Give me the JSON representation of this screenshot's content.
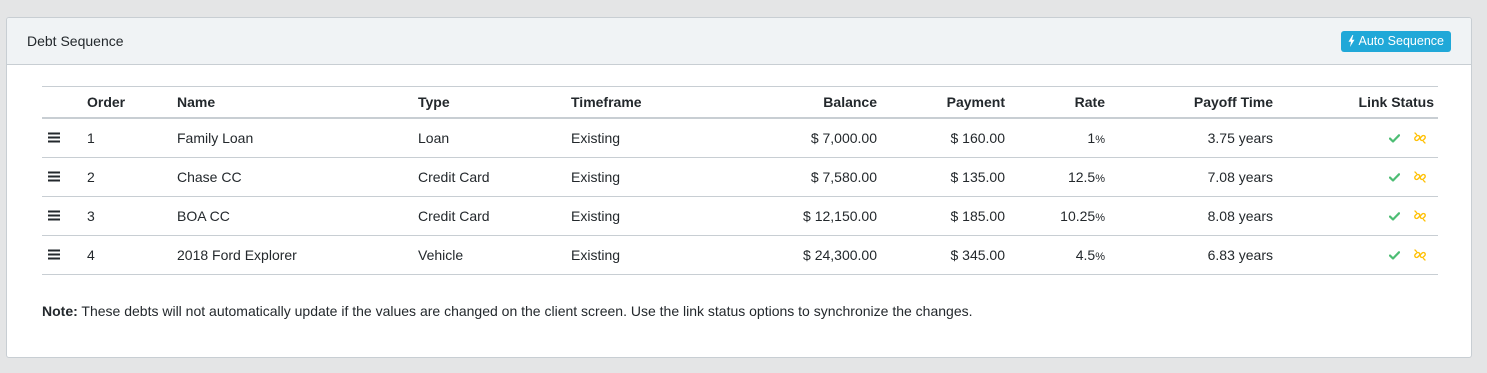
{
  "header": {
    "title": "Debt Sequence",
    "auto_button_label": "Auto Sequence"
  },
  "table": {
    "columns": [
      "",
      "Order",
      "Name",
      "Type",
      "Timeframe",
      "Balance",
      "Payment",
      "Rate",
      "Payoff Time",
      "Link Status"
    ],
    "rows": [
      {
        "order": "1",
        "name": "Family Loan",
        "type": "Loan",
        "timeframe": "Existing",
        "balance": "$ 7,000.00",
        "payment": "$ 160.00",
        "rate": "1",
        "payoff": "3.75 years"
      },
      {
        "order": "2",
        "name": "Chase CC",
        "type": "Credit Card",
        "timeframe": "Existing",
        "balance": "$ 7,580.00",
        "payment": "$ 135.00",
        "rate": "12.5",
        "payoff": "7.08 years"
      },
      {
        "order": "3",
        "name": "BOA CC",
        "type": "Credit Card",
        "timeframe": "Existing",
        "balance": "$ 12,150.00",
        "payment": "$ 185.00",
        "rate": "10.25",
        "payoff": "8.08 years"
      },
      {
        "order": "4",
        "name": "2018 Ford Explorer",
        "type": "Vehicle",
        "timeframe": "Existing",
        "balance": "$ 24,300.00",
        "payment": "$ 345.00",
        "rate": "4.5",
        "payoff": "6.83 years"
      }
    ],
    "rate_suffix": "%"
  },
  "note": {
    "label": "Note:",
    "text": " These debts will not automatically update if the values are changed on the client screen. Use the link status options to synchronize the changes."
  },
  "icons": {
    "drag": "drag-handle-icon",
    "bolt": "bolt-icon",
    "check": "check-icon",
    "unlink": "unlink-icon"
  },
  "colors": {
    "primary": "#20a8d8",
    "success": "#4dbd74",
    "warning": "#ffc107",
    "header_bg": "#f0f3f5",
    "border": "#c8ced3"
  }
}
